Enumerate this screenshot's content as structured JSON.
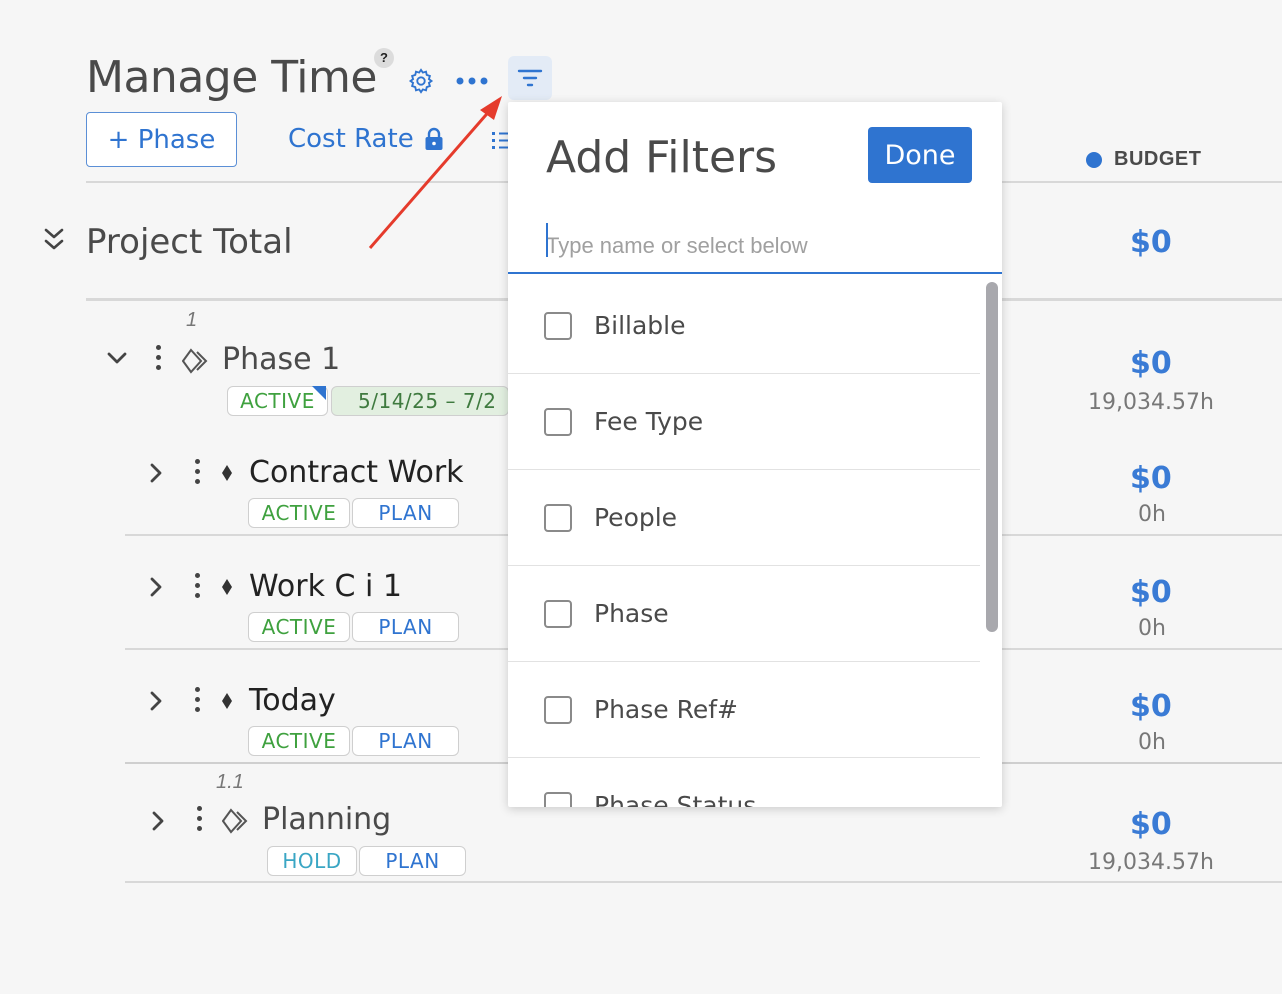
{
  "header": {
    "title": "Manage Time",
    "help": "?",
    "add_phase_label": "+ Phase",
    "cost_rate_label": "Cost Rate"
  },
  "columns": {
    "budget": "BUDGET"
  },
  "project_total": {
    "label": "Project Total",
    "budget": "$0"
  },
  "rows": [
    {
      "num": "1",
      "title": "Phase 1",
      "status": "ACTIVE",
      "date": "5/14/25  –  7/2",
      "budget": "$0",
      "hours": "19,034.57h"
    },
    {
      "title": "Contract Work",
      "status": "ACTIVE",
      "plan": "PLAN",
      "budget": "$0",
      "hours": "0h"
    },
    {
      "title": "Work C i 1",
      "status": "ACTIVE",
      "plan": "PLAN",
      "budget": "$0",
      "hours": "0h"
    },
    {
      "title": "Today",
      "status": "ACTIVE",
      "plan": "PLAN",
      "budget": "$0",
      "hours": "0h"
    },
    {
      "num": "1.1",
      "title": "Planning",
      "status": "HOLD",
      "plan": "PLAN",
      "budget": "$0",
      "hours": "19,034.57h"
    }
  ],
  "filters": {
    "title": "Add Filters",
    "done_label": "Done",
    "search_placeholder": "Type name or select below",
    "options": [
      "Billable",
      "Fee Type",
      "People",
      "Phase",
      "Phase Ref#",
      "Phase Status"
    ]
  },
  "colors": {
    "accent": "#2f74d0",
    "annotation_arrow": "#e53b2c"
  }
}
